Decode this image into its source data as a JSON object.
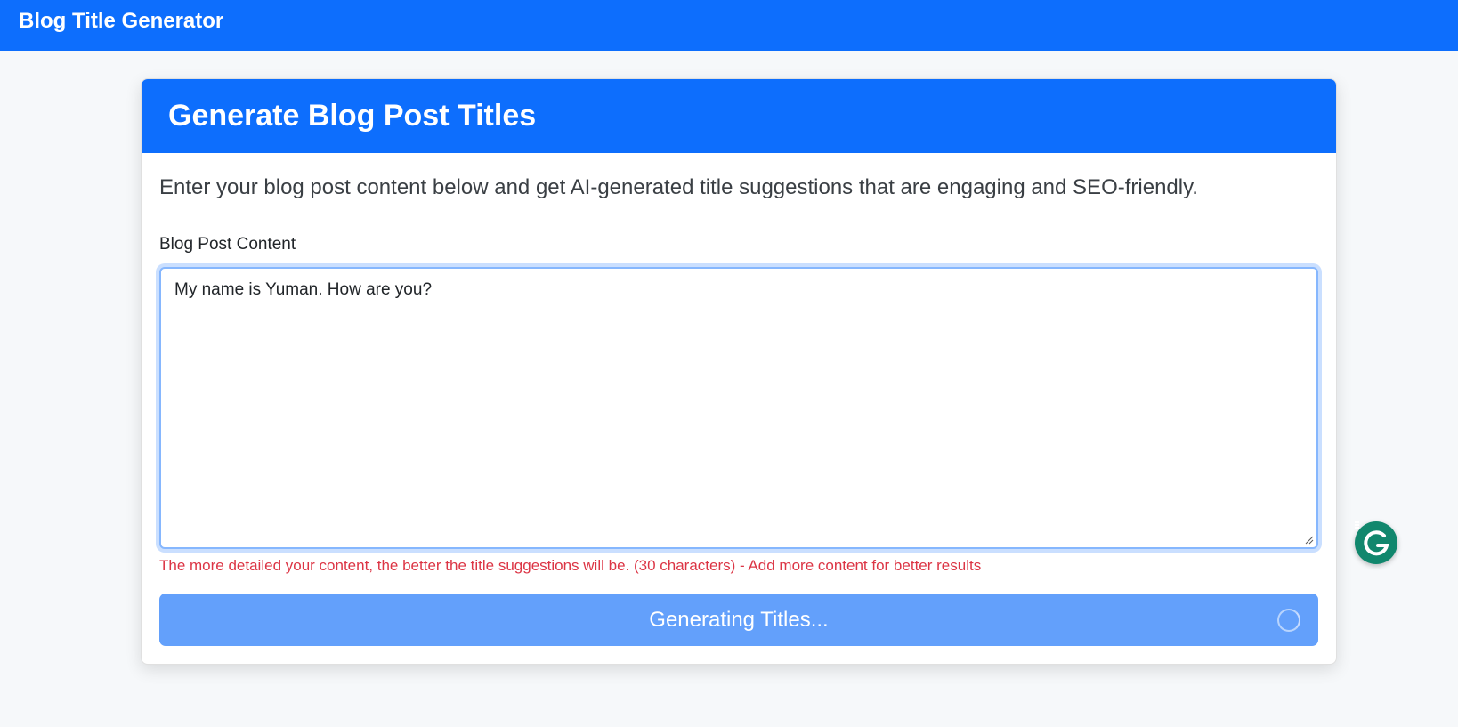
{
  "navbar": {
    "brand": "Blog Title Generator"
  },
  "card": {
    "title": "Generate Blog Post Titles",
    "lead": "Enter your blog post content below and get AI-generated title suggestions that are engaging and SEO-friendly.",
    "field_label": "Blog Post Content",
    "textarea_value": "My name is Yuman. How are you?",
    "help_text": "The more detailed your content, the better the title suggestions will be. (30 characters) - Add more content for better results",
    "submit_label": "Generating Titles..."
  },
  "extension": {
    "icon": "grammarly-icon"
  },
  "colors": {
    "primary": "#0d6efd",
    "button_disabled": "#63a0fb",
    "danger": "#dc3545",
    "grammarly": "#11876d"
  }
}
